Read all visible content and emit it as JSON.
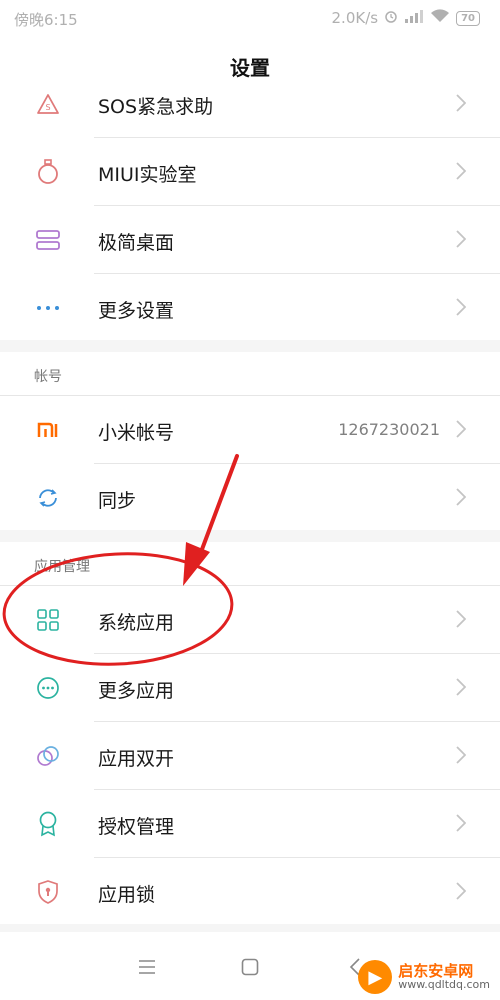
{
  "status_bar": {
    "time": "傍晚6:15",
    "speed": "2.0K/s",
    "battery": "70"
  },
  "header": {
    "title": "设置"
  },
  "top_section": {
    "items": [
      {
        "label": "SOS紧急求助"
      },
      {
        "label": "MIUI实验室"
      },
      {
        "label": "极简桌面"
      },
      {
        "label": "更多设置"
      }
    ]
  },
  "account_section": {
    "header": "帐号",
    "items": [
      {
        "label": "小米帐号",
        "value": "1267230021"
      },
      {
        "label": "同步"
      }
    ]
  },
  "apps_section": {
    "header": "应用管理",
    "items": [
      {
        "label": "系统应用"
      },
      {
        "label": "更多应用"
      },
      {
        "label": "应用双开"
      },
      {
        "label": "授权管理"
      },
      {
        "label": "应用锁"
      }
    ]
  },
  "watermark": {
    "title": "启东安卓网",
    "url": "www.qdltdq.com"
  },
  "colors": {
    "annotation_red": "#e02020",
    "mi_orange": "#ff6a00",
    "chevron": "#c4c4c4"
  }
}
